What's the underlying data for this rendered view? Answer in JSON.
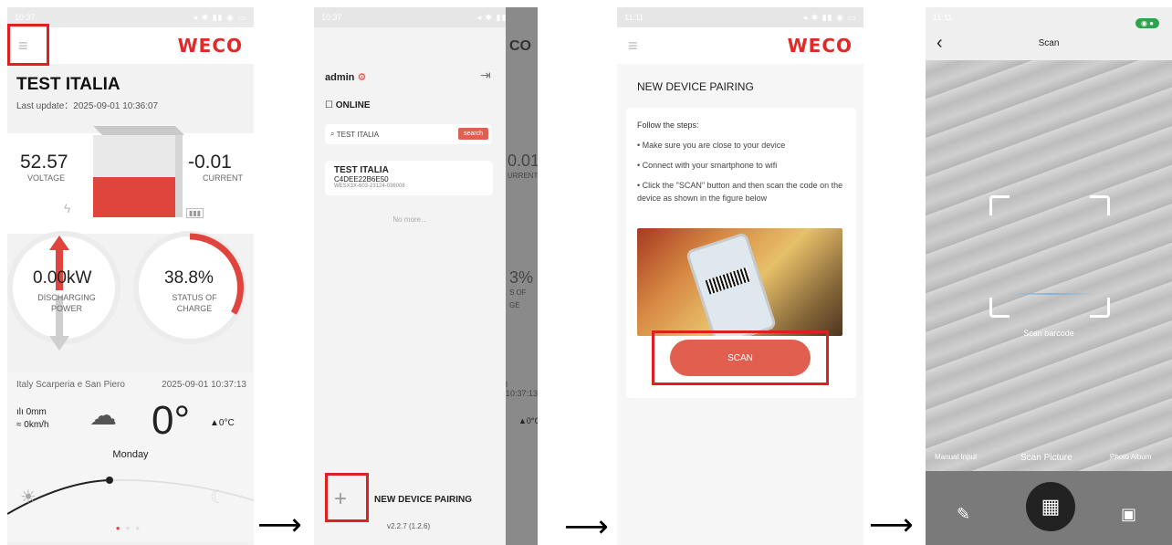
{
  "s1": {
    "status_time": "10:37",
    "logo": "WECO",
    "plant": "TEST ITALIA",
    "last_update": "Last update：2025-09-01 10:36:07",
    "voltage_value": "52.57",
    "voltage_label": "VOLTAGE",
    "current_value": "-0.01",
    "current_label": "CURRENT",
    "power_value": "0.00kW",
    "power_label": "DISCHARGING POWER",
    "soc_value": "38.8%",
    "soc_label": "STATUS OF CHARGE",
    "weather_location": "Italy Scarperia e San Piero",
    "weather_date": "2025-09-01 10:37:13",
    "rain": "0mm",
    "wind": "0km/h",
    "temperature": "0°",
    "temp_small": "▲0°C",
    "day": "Monday"
  },
  "s2": {
    "status_time": "10:37",
    "admin": "admin",
    "online": "ONLINE",
    "search_placeholder": "TEST ITALIA",
    "search_btn": "search",
    "device_name": "TEST ITALIA",
    "device_id": "C4DEE22B6E50",
    "device_sn": "WESX3X-603-23124-036008",
    "no_more": "No more...",
    "new_pairing": "NEW DEVICE PAIRING",
    "version": "v2.2.7 (1.2.6)"
  },
  "s3": {
    "status_time": "11:11",
    "logo": "WECO",
    "title": "NEW DEVICE PAIRING",
    "steps_title": "Follow the steps:",
    "step1": "Make sure you are close to your device",
    "step2": "Connect with your smartphone to wifi",
    "step3": "Click the \"SCAN\" button and then scan the code on the device as shown in the figure below",
    "scan_btn": "SCAN"
  },
  "s4": {
    "status_time": "11:11",
    "title": "Scan",
    "hint": "Scan barcode",
    "manual": "Manual Input",
    "scan_picture": "Scan Picture",
    "photo_album": "Photo Album"
  }
}
